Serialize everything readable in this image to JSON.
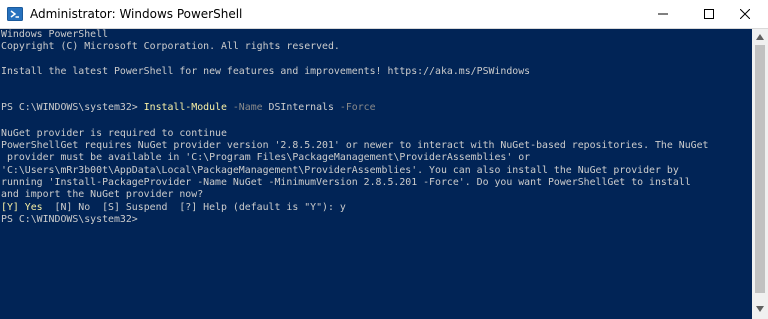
{
  "window": {
    "title": "Administrator: Windows PowerShell",
    "icon": "powershell-icon",
    "controls": [
      "minimize-icon",
      "maximize-icon",
      "close-icon"
    ],
    "background_color": "#012456",
    "titlebar_color": "#ffffff"
  },
  "console": {
    "header_line_1": "Windows PowerShell",
    "header_line_2": "Copyright (C) Microsoft Corporation. All rights reserved.",
    "install_hint": "Install the latest PowerShell for new features and improvements! https://aka.ms/PSWindows",
    "prompt_1": "PS C:\\WINDOWS\\system32> ",
    "cmd_name": "Install-Module",
    "cmd_param_name": " -Name ",
    "cmd_module": "DSInternals",
    "cmd_param_force": " -Force",
    "nuget_heading": "NuGet provider is required to continue",
    "nuget_line_1": "PowerShellGet requires NuGet provider version '2.8.5.201' or newer to interact with NuGet-based repositories. The NuGet",
    "nuget_line_2": " provider must be available in 'C:\\Program Files\\PackageManagement\\ProviderAssemblies' or",
    "nuget_line_3": "'C:\\Users\\mRr3b00t\\AppData\\Local\\PackageManagement\\ProviderAssemblies'. You can also install the NuGet provider by",
    "nuget_line_4": "running 'Install-PackageProvider -Name NuGet -MinimumVersion 2.8.5.201 -Force'. Do you want PowerShellGet to install",
    "nuget_line_5": "and import the NuGet provider now?",
    "choice_yes": "[Y] Yes",
    "choice_rest": "  [N] No  [S] Suspend  [?] Help (default is \"Y\"): y",
    "prompt_2": "PS C:\\WINDOWS\\system32>",
    "text_color": "#cccccc",
    "command_color": "#f9f1a5",
    "parameter_color": "#8a8a8a"
  },
  "scrollbar": {
    "track_color": "#f0f0f0",
    "thumb_color": "#c1c1c1"
  }
}
